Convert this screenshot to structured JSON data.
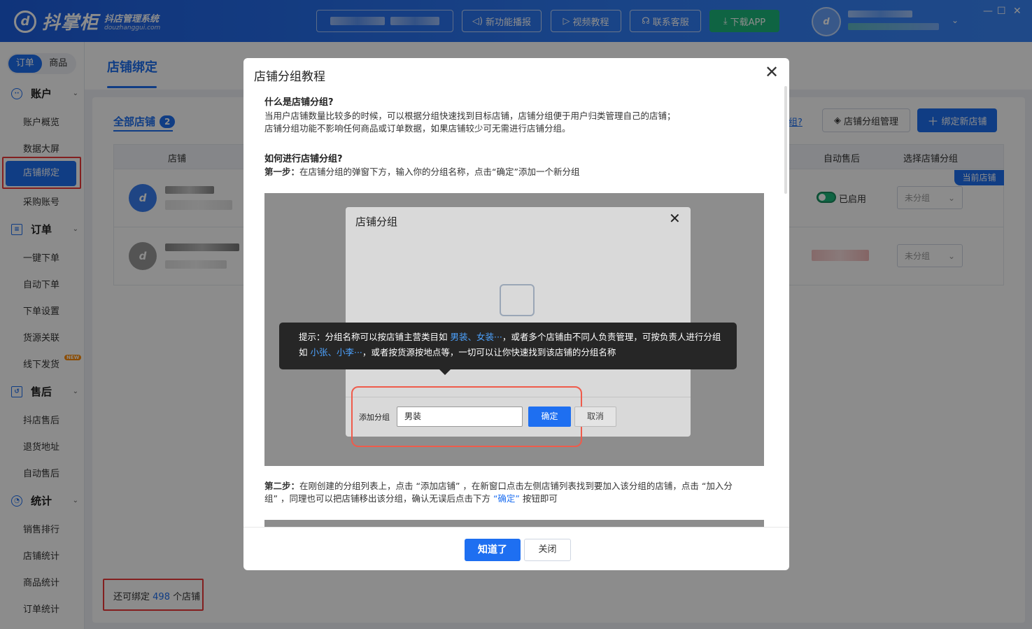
{
  "app": {
    "logo_text": "抖掌柜",
    "logo_sub": "抖店管理系统",
    "logo_domain": "douzhanggui.com"
  },
  "topbar": {
    "buttons": [
      {
        "label": "新功能播报",
        "icon": "speaker-icon"
      },
      {
        "label": "视频教程",
        "icon": "play-icon"
      },
      {
        "label": "联系客服",
        "icon": "headset-icon"
      },
      {
        "label": "下载APP",
        "icon": "download-icon"
      }
    ]
  },
  "sidebar": {
    "tabs": [
      "订单",
      "商品"
    ],
    "groups": [
      {
        "title": "账户",
        "icon": "account-icon",
        "items": [
          "账户概览",
          "数据大屏",
          "店铺绑定",
          "采购账号"
        ]
      },
      {
        "title": "订单",
        "icon": "order-icon",
        "items": [
          "一键下单",
          "自动下单",
          "下单设置",
          "货源关联",
          "线下发货"
        ]
      },
      {
        "title": "售后",
        "icon": "aftersale-icon",
        "items": [
          "抖店售后",
          "退货地址",
          "自动售后"
        ]
      },
      {
        "title": "统计",
        "icon": "chart-icon",
        "items": [
          "销售排行",
          "店铺统计",
          "商品统计",
          "订单统计"
        ]
      }
    ],
    "active_item": "店铺绑定",
    "new_badge": "NEW"
  },
  "page": {
    "title": "店铺绑定",
    "tab_all": "全部店铺",
    "tab_count": "2",
    "help_link": "组?",
    "btn_group_manage": "店铺分组管理",
    "btn_bind_new": "绑定新店铺",
    "columns": {
      "shop": "店铺",
      "auto_aftersale": "自动售后",
      "select_group": "选择店铺分组"
    },
    "current_shop_badge": "当前店铺",
    "row1": {
      "auto_aftersale": "已启用",
      "group": "未分组"
    },
    "row2": {
      "group": "未分组"
    },
    "bottom_prefix": "还可绑定",
    "bottom_count": "498",
    "bottom_suffix": "个店铺"
  },
  "modal": {
    "title": "店铺分组教程",
    "q1": "什么是店铺分组?",
    "a1_line1": "当用户店铺数量比较多的时候，可以根据分组快速找到目标店铺，店铺分组便于用户归类管理自己的店铺；",
    "a1_line2": "店铺分组功能不影响任何商品或订单数据，如果店铺较少可无需进行店铺分组。",
    "q2": "如何进行店铺分组?",
    "step1_label": "第一步：",
    "step1_text": "在店铺分组的弹窗下方，输入你的分组名称，点击“确定”添加一个新分组",
    "inner": {
      "title": "店铺分组",
      "tip_prefix": "提示：分组名称可以按店铺主营类目如 ",
      "tip_blue1": "男装、女装···",
      "tip_mid": "，或者多个店铺由不同人负责管理，可按负责人进行分组",
      "tip_line2_prefix": "如 ",
      "tip_blue2": "小张、小李···",
      "tip_line2_suffix": "，或者按货源按地点等，一切可以让你快速找到该店铺的分组名称",
      "add_label": "添加分组",
      "input_value": "男装",
      "ok": "确定",
      "cancel": "取消"
    },
    "step2_label": "第二步：",
    "step2_text_a": "在刚创建的分组列表上，点击 “添加店铺” ，在新窗口点击左侧店铺列表找到要加入该分组的店铺，点击 “加入分",
    "step2_text_b": "组” ，同理也可以把店铺移出该分组，确认无误后点击下方 ",
    "step2_blue": "“确定”",
    "step2_text_c": " 按钮即可",
    "btn_ok": "知道了",
    "btn_close": "关闭"
  },
  "colors": {
    "primary": "#1e6ff1",
    "highlight_red": "#ef3a3a",
    "success": "#1cb67a"
  }
}
